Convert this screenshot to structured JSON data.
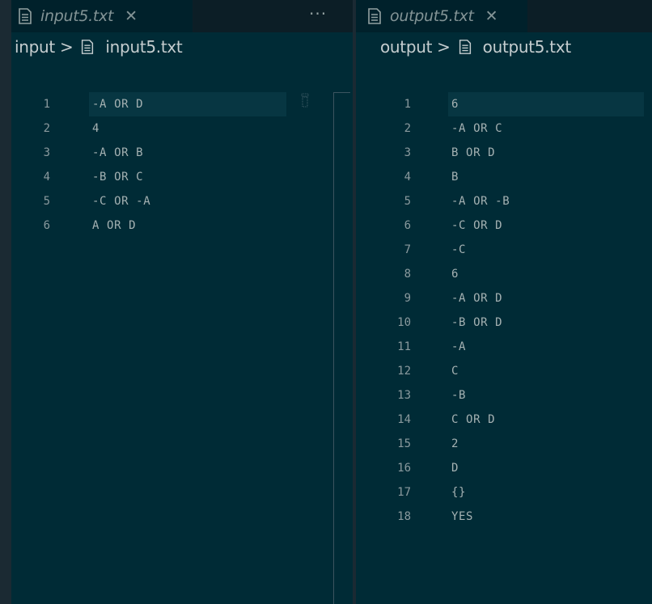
{
  "colors": {
    "editor_background": "#002b36",
    "tab_background": "#00212b",
    "line_highlight": "#073642",
    "text": "#a5b2b3"
  },
  "left_editor": {
    "tab": {
      "title": "input5.txt",
      "icon": "file-text-icon",
      "close_glyph": "✕"
    },
    "more_actions": "···",
    "breadcrumb": {
      "folder": "input",
      "separator": ">",
      "file": "input5.txt"
    },
    "lines": [
      {
        "number": "1",
        "text": "-A OR D"
      },
      {
        "number": "2",
        "text": "4"
      },
      {
        "number": "3",
        "text": "-A OR B"
      },
      {
        "number": "4",
        "text": "-B OR C"
      },
      {
        "number": "5",
        "text": "-C OR -A"
      },
      {
        "number": "6",
        "text": "A OR D"
      }
    ]
  },
  "right_editor": {
    "tab": {
      "title": "output5.txt",
      "icon": "file-text-icon",
      "close_glyph": "✕"
    },
    "breadcrumb": {
      "folder": "output",
      "separator": ">",
      "file": "output5.txt"
    },
    "lines": [
      {
        "number": "1",
        "text": "6"
      },
      {
        "number": "2",
        "text": "-A OR C"
      },
      {
        "number": "3",
        "text": "B OR D"
      },
      {
        "number": "4",
        "text": "B"
      },
      {
        "number": "5",
        "text": "-A OR -B"
      },
      {
        "number": "6",
        "text": "-C OR D"
      },
      {
        "number": "7",
        "text": "-C"
      },
      {
        "number": "8",
        "text": "6"
      },
      {
        "number": "9",
        "text": "-A OR D"
      },
      {
        "number": "10",
        "text": "-B OR D"
      },
      {
        "number": "11",
        "text": "-A"
      },
      {
        "number": "12",
        "text": "C"
      },
      {
        "number": "13",
        "text": "-B"
      },
      {
        "number": "14",
        "text": "C OR D"
      },
      {
        "number": "15",
        "text": "2"
      },
      {
        "number": "16",
        "text": "D"
      },
      {
        "number": "17",
        "text": "{}"
      },
      {
        "number": "18",
        "text": "YES"
      }
    ]
  }
}
